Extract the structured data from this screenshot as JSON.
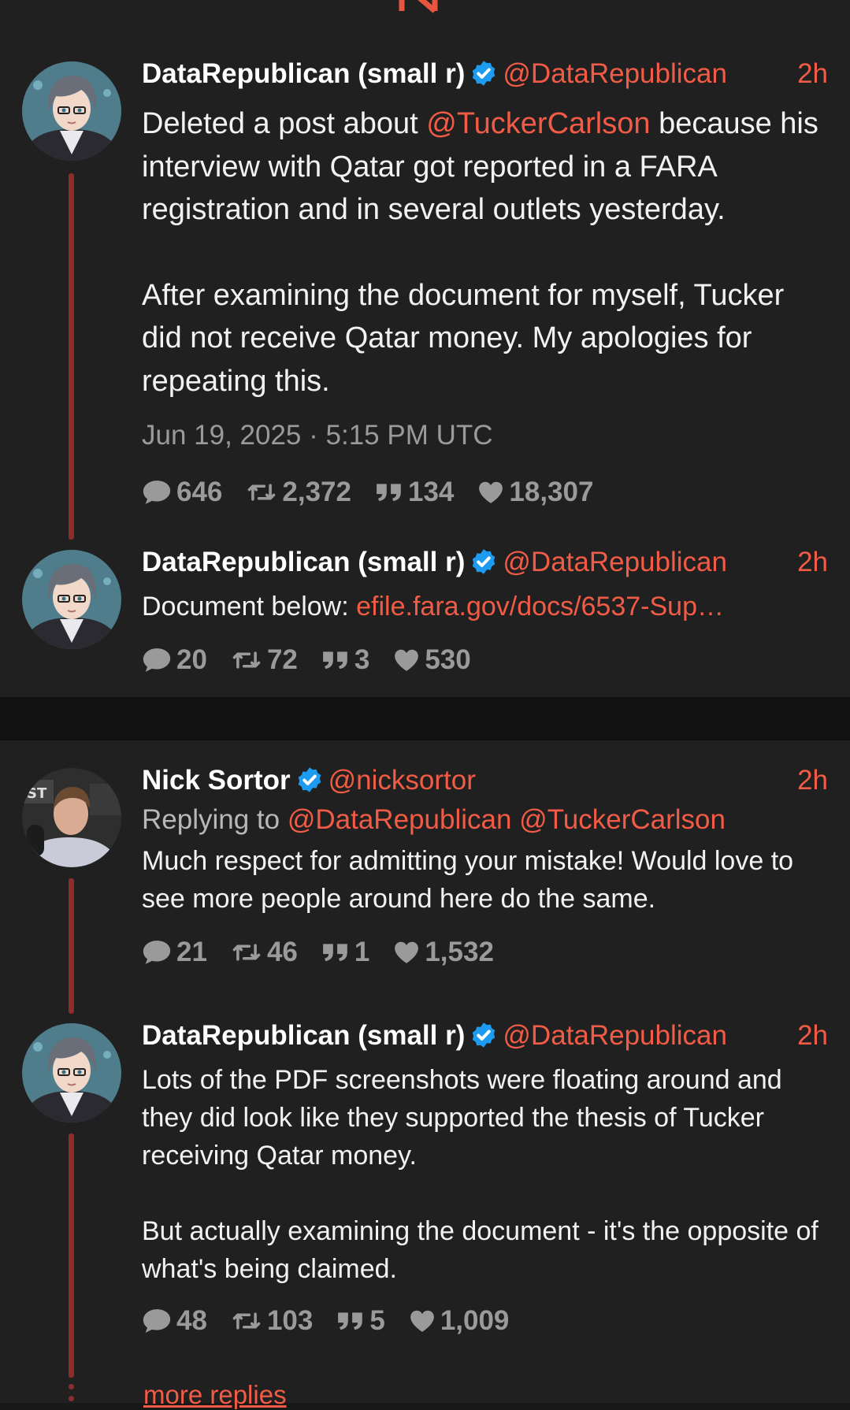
{
  "colors": {
    "accent": "#f25b45",
    "background": "#181818",
    "card": "#202020",
    "thread_line": "#8f2b2b",
    "muted": "#9a9a9a",
    "verified": "#1d9bf0"
  },
  "thread1": {
    "main": {
      "name": "DataRepublican (small r)",
      "handle": "@DataRepublican",
      "time": "2h",
      "text_line1_pre": "Deleted a post about ",
      "mention": "@TuckerCarlson",
      "text_line1_post": " because his interview with Qatar got reported in a FARA registration and in several outlets yesterday.",
      "paragraph2": "After examining the document for myself, Tucker did not receive Qatar money. My apologies for repeating this.",
      "date": "Jun 19, 2025 · 5:15 PM UTC",
      "stats": {
        "replies": "646",
        "retweets": "2,372",
        "quotes": "134",
        "likes": "18,307"
      }
    },
    "reply": {
      "name": "DataRepublican (small r)",
      "handle": "@DataRepublican",
      "time": "2h",
      "text_pre": "Document below: ",
      "link": "efile.fara.gov/docs/6537-Sup…",
      "stats": {
        "replies": "20",
        "retweets": "72",
        "quotes": "3",
        "likes": "530"
      }
    }
  },
  "thread2": {
    "main": {
      "name": "Nick Sortor",
      "handle": "@nicksortor",
      "time": "2h",
      "replying_label": "Replying to",
      "replying_to_1": "@DataRepublican",
      "replying_to_2": "@TuckerCarlson",
      "text": "Much respect for admitting your mistake! Would love to see more people around here do the same.",
      "stats": {
        "replies": "21",
        "retweets": "46",
        "quotes": "1",
        "likes": "1,532"
      }
    },
    "reply": {
      "name": "DataRepublican (small r)",
      "handle": "@DataRepublican",
      "time": "2h",
      "paragraph1": "Lots of the PDF screenshots were floating around and they did look like they supported the thesis of Tucker receiving Qatar money.",
      "paragraph2": "But actually examining the document - it's the opposite of what's being claimed.",
      "stats": {
        "replies": "48",
        "retweets": "103",
        "quotes": "5",
        "likes": "1,009"
      }
    },
    "more_replies": "more replies"
  }
}
